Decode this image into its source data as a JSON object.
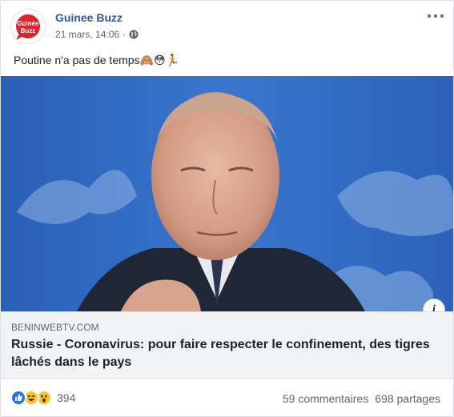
{
  "colors": {
    "link_blue": "#385898",
    "grey_text": "#606770",
    "photo_bg": "#2d63b8"
  },
  "header": {
    "page_name": "Guinee Buzz",
    "timestamp": "21 mars, 14:06",
    "separator": "·",
    "avatar_text_line1": "Guinée",
    "avatar_text_line2": "Buzz",
    "privacy_icon": "globe-icon",
    "menu_icon": "more-dots-icon"
  },
  "post": {
    "text": "Poutine n'a pas de temps🙈😳🏃"
  },
  "link": {
    "domain": "BENINWEBTV.COM",
    "title": "Russie - Coronavirus: pour faire respecter le confinement, des tigres lâchés dans le pays",
    "info_icon": "info-icon",
    "info_label": "i"
  },
  "footer": {
    "reactions": [
      "like-icon",
      "haha-icon",
      "wow-icon"
    ],
    "reaction_count": "394",
    "comments": "59 commentaires",
    "shares": "698 partages"
  }
}
